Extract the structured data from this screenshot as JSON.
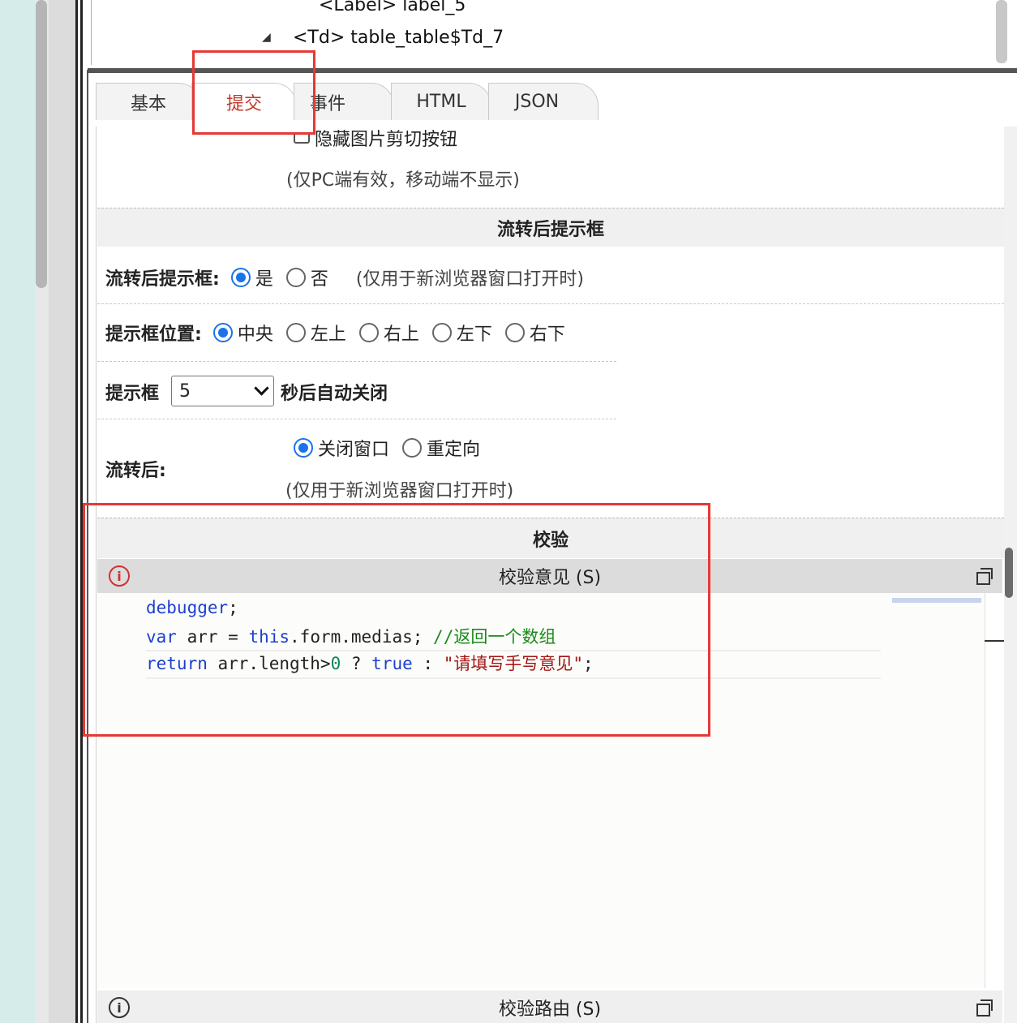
{
  "tree": {
    "label_node": "<Label> label_5",
    "td_node": "<Td> table_table$Td_7",
    "expand_arrow": "◢"
  },
  "tabs": [
    {
      "label": "基本",
      "active": false
    },
    {
      "label": "提交",
      "active": true
    },
    {
      "label": "事件",
      "active": false
    },
    {
      "label": "HTML",
      "active": false
    },
    {
      "label": "JSON",
      "active": false
    }
  ],
  "hide_crop": {
    "label": "隐藏图片剪切按钮",
    "note": "(仅PC端有效，移动端不显示)"
  },
  "after_prompt": {
    "section_title": "流转后提示框",
    "label": "流转后提示框:",
    "yes": "是",
    "no": "否",
    "note": "(仅用于新浏览器窗口打开时)",
    "position_label": "提示框位置:",
    "positions": [
      "中央",
      "左上",
      "右上",
      "左下",
      "右下"
    ],
    "box_label": "提示框",
    "box_seconds": "5",
    "box_suffix": "秒后自动关闭",
    "after_label": "流转后:",
    "close_window": "关闭窗口",
    "redirect": "重定向",
    "after_note": "(仅用于新浏览器窗口打开时)"
  },
  "validation": {
    "section_title": "校验",
    "opinion_title": "校验意见 (S)",
    "route_title": "校验路由 (S)",
    "info_glyph": "i"
  },
  "code": {
    "line1": "debugger",
    "line1_end": ";",
    "line2_kw": "var",
    "line2_a": " arr = ",
    "line2_this": "this",
    "line2_b": ".form.medias; ",
    "line2_comment": "//返回一个数组",
    "line3_kw": "return",
    "line3_a": " arr.length>",
    "line3_num": "0",
    "line3_b": " ? ",
    "line3_true": "true",
    "line3_c": " : ",
    "line3_str": "\"请填写手写意见\"",
    "line3_end": ";"
  },
  "colors": {
    "highlight_box": "#e53935",
    "radio_checked": "#1a73e8",
    "active_tab_text": "#c0392b"
  }
}
